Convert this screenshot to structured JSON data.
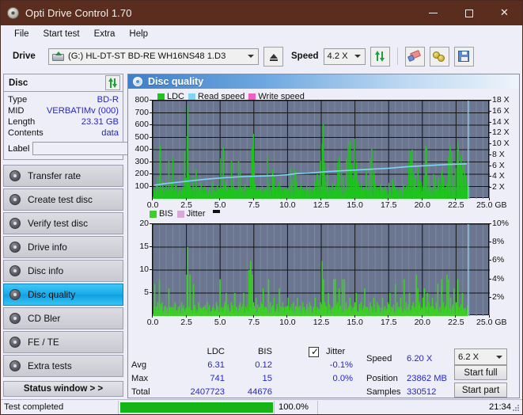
{
  "window": {
    "title": "Opti Drive Control 1.70",
    "icon": "disc-icon",
    "controls": {
      "minimize": "minimize-icon",
      "maximize": "maximize-icon",
      "close": "close-icon"
    }
  },
  "menubar": {
    "items": [
      "File",
      "Start test",
      "Extra",
      "Help"
    ]
  },
  "toolbar": {
    "drive_label": "Drive",
    "drive_value": "(G:)  HL-DT-ST BD-RE  WH16NS48 1.D3",
    "eject_icon": "eject-icon",
    "speed_label": "Speed",
    "speed_value": "4.2 X",
    "refresh_icon": "refresh-icon",
    "erase_icon": "eraser-icon",
    "gold_icon": "coins-icon",
    "save_icon": "save-icon"
  },
  "disc_panel": {
    "title": "Disc",
    "refresh_icon": "refresh-icon",
    "rows": [
      {
        "key": "Type",
        "value": "BD-R"
      },
      {
        "key": "MID",
        "value": "VERBATIMv (000)"
      },
      {
        "key": "Length",
        "value": "23.31 GB"
      },
      {
        "key": "Contents",
        "value": "data"
      }
    ],
    "label_key": "Label",
    "label_value": "",
    "label_placeholder": "",
    "disc_icon": "cd-icon"
  },
  "nav": {
    "items": [
      {
        "id": "transfer-rate",
        "label": "Transfer rate",
        "active": false
      },
      {
        "id": "create-test-disc",
        "label": "Create test disc",
        "active": false
      },
      {
        "id": "verify-test-disc",
        "label": "Verify test disc",
        "active": false
      },
      {
        "id": "drive-info",
        "label": "Drive info",
        "active": false
      },
      {
        "id": "disc-info",
        "label": "Disc info",
        "active": false
      },
      {
        "id": "disc-quality",
        "label": "Disc quality",
        "active": true
      },
      {
        "id": "cd-bler",
        "label": "CD Bler",
        "active": false
      },
      {
        "id": "fe-te",
        "label": "FE / TE",
        "active": false
      },
      {
        "id": "extra-tests",
        "label": "Extra tests",
        "active": false
      }
    ],
    "status_window_label": "Status window > >"
  },
  "panel": {
    "title": "Disc quality",
    "icon": "disc-quality-icon"
  },
  "colors": {
    "ldc_green": "#1fc41f",
    "read_speed": "#7fd4f5",
    "write_speed": "#ef5fc8",
    "bis_green": "#3fce2a",
    "jitter": "#d8a8d8",
    "plot_bg": "#6b7690",
    "accent": "#2626c8",
    "title_bar": "#5a2d1e",
    "progress": "#14b514"
  },
  "stats": {
    "col_headers": [
      "LDC",
      "BIS"
    ],
    "rows": [
      {
        "label": "Avg",
        "ldc": "6.31",
        "bis": "0.12",
        "jitter": "-0.1%"
      },
      {
        "label": "Max",
        "ldc": "741",
        "bis": "15",
        "jitter": "0.0%"
      },
      {
        "label": "Total",
        "ldc": "2407723",
        "bis": "44676",
        "jitter": ""
      }
    ],
    "jitter_label": "Jitter",
    "jitter_checked": true,
    "speed_label": "Speed",
    "speed_value": "6.20 X",
    "position_label": "Position",
    "position_value": "23862 MB",
    "samples_label": "Samples",
    "samples_value": "330512",
    "speed_select": "6.2 X",
    "start_full_label": "Start full",
    "start_part_label": "Start part"
  },
  "statusbar": {
    "text": "Test completed",
    "percent_label": "100.0%",
    "percent_value": 100,
    "time": "21:34"
  },
  "chart_data": [
    {
      "id": "ldc-chart",
      "type": "bar",
      "title": "Disc quality",
      "xlabel": "GB",
      "ylabel": "",
      "xlim": [
        0,
        25
      ],
      "ylim": [
        0,
        800
      ],
      "y2lim": [
        0,
        18
      ],
      "y2label": "X",
      "grid": true,
      "legend": [
        {
          "name": "LDC",
          "color": "#1fc41f"
        },
        {
          "name": "Read speed",
          "color": "#7fd4f5"
        },
        {
          "name": "Write speed",
          "color": "#ef5fc8"
        }
      ],
      "xticks": [
        "0.0",
        "2.5",
        "5.0",
        "7.5",
        "10.0",
        "12.5",
        "15.0",
        "17.5",
        "20.0",
        "22.5",
        "25.0 GB"
      ],
      "yticks": [
        100,
        200,
        300,
        400,
        500,
        600,
        700,
        800
      ],
      "y2ticks": [
        "2 X",
        "4 X",
        "6 X",
        "8 X",
        "10 X",
        "12 X",
        "14 X",
        "16 X",
        "18 X"
      ],
      "series": [
        {
          "name": "LDC",
          "color": "#1fc41f",
          "kind": "bar",
          "x": [
            0.1,
            0.22,
            0.33,
            0.45,
            0.52,
            0.62,
            0.7,
            0.82,
            0.95,
            1.05,
            1.15,
            1.25,
            1.32,
            1.45,
            1.58,
            1.7,
            1.85,
            1.95,
            2.08,
            2.2,
            2.32,
            2.42,
            2.5,
            2.56,
            2.62,
            2.7,
            2.82,
            2.95,
            3.05,
            3.18,
            3.3,
            3.42,
            3.55,
            3.68,
            3.8,
            3.95,
            4.08,
            4.2,
            4.35,
            4.5,
            4.62,
            4.75,
            4.88,
            5.0,
            5.08,
            5.18,
            5.3,
            5.38,
            5.45,
            5.55,
            5.68,
            5.8,
            5.95,
            6.08,
            6.2,
            6.32,
            6.45,
            6.55,
            6.68,
            6.8,
            6.95,
            7.08,
            7.2,
            7.32,
            7.42,
            7.48,
            7.55,
            7.65,
            7.78,
            7.9,
            8.05,
            8.18,
            8.3,
            8.45,
            8.58,
            8.7,
            8.85,
            8.95,
            9.08,
            9.2,
            9.32,
            9.45,
            9.58,
            9.7,
            9.85,
            9.95,
            10.08,
            10.2,
            10.32,
            10.45,
            10.55,
            10.62,
            10.72,
            10.85,
            10.95,
            11.08,
            11.2,
            11.35,
            11.48,
            11.6,
            11.75,
            11.88,
            12.0,
            12.15,
            12.28,
            12.4,
            12.52,
            12.6,
            12.68,
            12.78,
            12.9,
            13.02,
            13.15,
            13.28,
            13.4,
            13.55,
            13.68,
            13.8,
            13.95,
            14.08,
            14.2,
            14.32,
            14.45,
            14.58,
            14.7,
            14.82,
            14.92,
            15.0,
            15.08,
            15.18,
            15.3,
            15.42,
            15.55,
            15.68,
            15.8,
            15.95,
            16.08,
            16.2,
            16.35,
            16.45,
            16.58,
            16.7,
            16.85,
            16.95,
            17.08,
            17.2,
            17.35,
            17.48,
            17.6,
            17.75,
            17.88,
            18.0,
            18.15,
            18.28,
            18.4,
            18.55,
            18.68,
            18.8,
            18.95,
            19.08,
            19.2,
            19.32,
            19.4,
            19.5,
            19.62,
            19.75,
            19.88,
            20.0,
            20.08,
            20.18,
            20.28,
            20.4,
            20.52,
            20.65,
            20.78,
            20.9,
            21.02,
            21.15,
            21.28,
            21.4,
            21.52,
            21.65,
            21.78,
            21.9,
            22.02,
            22.15,
            22.28,
            22.4,
            22.52,
            22.62,
            22.72,
            22.82,
            22.9,
            22.98,
            23.08,
            23.18,
            23.28,
            23.35
          ],
          "values": [
            60,
            120,
            180,
            80,
            440,
            90,
            150,
            70,
            110,
            60,
            310,
            80,
            140,
            330,
            70,
            120,
            60,
            90,
            70,
            100,
            390,
            170,
            510,
            760,
            200,
            110,
            80,
            180,
            60,
            240,
            90,
            70,
            130,
            60,
            100,
            70,
            60,
            90,
            140,
            70,
            60,
            110,
            80,
            330,
            90,
            420,
            110,
            140,
            60,
            70,
            90,
            310,
            120,
            60,
            80,
            310,
            230,
            90,
            70,
            120,
            60,
            90,
            180,
            420,
            530,
            300,
            120,
            70,
            60,
            80,
            60,
            70,
            90,
            340,
            130,
            70,
            240,
            180,
            90,
            70,
            140,
            100,
            60,
            90,
            80,
            70,
            110,
            250,
            160,
            240,
            230,
            140,
            90,
            70,
            120,
            60,
            80,
            90,
            70,
            100,
            60,
            80,
            140,
            200,
            160,
            310,
            450,
            610,
            300,
            140,
            200,
            60,
            90,
            130,
            70,
            110,
            300,
            340,
            240,
            180,
            90,
            330,
            430,
            470,
            280,
            160,
            490,
            230,
            300,
            140,
            90,
            120,
            70,
            90,
            250,
            150,
            330,
            410,
            220,
            130,
            90,
            70,
            120,
            60,
            80,
            100,
            70,
            130,
            90,
            160,
            110,
            70,
            60,
            90,
            70,
            120,
            80,
            110,
            300,
            390,
            400,
            220,
            170,
            90,
            260,
            150,
            140,
            90,
            190,
            430,
            420,
            190,
            110,
            90,
            200,
            160,
            80,
            170,
            120,
            230,
            180,
            90,
            130,
            340,
            430,
            380,
            190,
            250,
            400,
            460,
            280,
            360,
            240,
            140,
            300,
            190,
            110,
            180
          ],
          "width": 0.04
        },
        {
          "name": "Read speed",
          "color": "#7fd4f5",
          "kind": "line",
          "axis": "y2",
          "x": [
            0.1,
            1.0,
            2.5,
            4.0,
            5.5,
            7.0,
            8.5,
            10.0,
            10.6,
            11.5,
            13.0,
            14.5,
            16.0,
            17.5,
            19.0,
            20.5,
            22.0,
            23.3
          ],
          "values": [
            2.5,
            2.8,
            3.2,
            3.6,
            3.9,
            4.1,
            4.2,
            4.4,
            4.6,
            4.7,
            5.0,
            5.2,
            5.4,
            5.6,
            5.9,
            6.1,
            6.3,
            6.4
          ]
        }
      ],
      "cursor_x": 23.4
    },
    {
      "id": "bis-chart",
      "type": "bar",
      "xlabel": "GB",
      "xlim": [
        0,
        25
      ],
      "ylim": [
        0,
        20
      ],
      "y2lim": [
        0,
        10
      ],
      "y2label": "%",
      "grid": true,
      "legend": [
        {
          "name": "BIS",
          "color": "#3fce2a"
        },
        {
          "name": "Jitter",
          "color": "#d8a8d8"
        }
      ],
      "xticks": [
        "0.0",
        "2.5",
        "5.0",
        "7.5",
        "10.0",
        "12.5",
        "15.0",
        "17.5",
        "20.0",
        "22.5",
        "25.0 GB"
      ],
      "yticks": [
        5,
        10,
        15,
        20
      ],
      "y2ticks": [
        "2%",
        "4%",
        "6%",
        "8%",
        "10%"
      ],
      "series": [
        {
          "name": "BIS",
          "color": "#3fce2a",
          "kind": "bar",
          "x": [
            0.1,
            0.22,
            0.33,
            0.45,
            0.55,
            0.65,
            0.78,
            0.9,
            1.02,
            1.15,
            1.22,
            1.35,
            1.48,
            1.6,
            1.72,
            1.85,
            1.98,
            2.1,
            2.22,
            2.35,
            2.48,
            2.55,
            2.65,
            2.72,
            2.85,
            2.98,
            3.1,
            3.22,
            3.35,
            3.48,
            3.6,
            3.75,
            3.88,
            4.0,
            4.15,
            4.28,
            4.4,
            4.55,
            4.68,
            4.8,
            4.95,
            5.08,
            5.2,
            5.32,
            5.4,
            5.52,
            5.65,
            5.78,
            5.9,
            6.05,
            6.18,
            6.3,
            6.45,
            6.58,
            6.7,
            6.85,
            6.98,
            7.1,
            7.22,
            7.35,
            7.42,
            7.5,
            7.62,
            7.75,
            7.88,
            8.0,
            8.15,
            8.28,
            8.4,
            8.55,
            8.68,
            8.8,
            8.95,
            9.08,
            9.2,
            9.35,
            9.48,
            9.6,
            9.75,
            9.88,
            10.0,
            10.15,
            10.28,
            10.4,
            10.55,
            10.68,
            10.8,
            10.95,
            11.08,
            11.2,
            11.35,
            11.48,
            11.6,
            11.75,
            11.88,
            12.0,
            12.15,
            12.28,
            12.4,
            12.52,
            12.62,
            12.72,
            12.85,
            12.98,
            13.1,
            13.25,
            13.38,
            13.5,
            13.65,
            13.78,
            13.9,
            14.05,
            14.18,
            14.3,
            14.45,
            14.58,
            14.7,
            14.85,
            14.95,
            15.05,
            15.15,
            15.28,
            15.4,
            15.55,
            15.68,
            15.8,
            15.95,
            16.08,
            16.2,
            16.35,
            16.48,
            16.6,
            16.75,
            16.88,
            17.0,
            17.15,
            17.28,
            17.4,
            17.55,
            17.68,
            17.8,
            17.95,
            18.08,
            18.2,
            18.35,
            18.48,
            18.6,
            18.75,
            18.88,
            19.0,
            19.15,
            19.28,
            19.4,
            19.5,
            19.62,
            19.75,
            19.88,
            20.0,
            20.1,
            20.2,
            20.32,
            20.45,
            20.58,
            20.7,
            20.85,
            20.98,
            21.1,
            21.25,
            21.38,
            21.5,
            21.65,
            21.78,
            21.9,
            22.05,
            22.18,
            22.3,
            22.45,
            22.58,
            22.7,
            22.82,
            22.92,
            23.02,
            23.12,
            23.22,
            23.32
          ],
          "values": [
            7,
            2,
            3,
            8,
            2,
            3,
            1,
            2,
            1,
            6,
            2,
            1,
            2,
            3,
            1,
            2,
            1,
            3,
            2,
            1,
            9,
            15,
            2,
            9,
            1,
            7,
            2,
            1,
            3,
            2,
            1,
            2,
            1,
            3,
            2,
            1,
            2,
            1,
            3,
            2,
            8,
            2,
            1,
            3,
            5,
            2,
            1,
            3,
            2,
            5,
            2,
            1,
            3,
            2,
            5,
            2,
            1,
            10,
            12,
            9,
            3,
            2,
            4,
            1,
            2,
            3,
            6,
            2,
            1,
            8,
            3,
            2,
            4,
            1,
            2,
            6,
            2,
            3,
            1,
            2,
            4,
            2,
            1,
            3,
            2,
            4,
            2,
            1,
            3,
            2,
            1,
            2,
            3,
            1,
            2,
            4,
            2,
            1,
            3,
            12,
            8,
            3,
            2,
            5,
            1,
            2,
            8,
            8,
            3,
            6,
            2,
            8,
            8,
            3,
            2,
            4,
            1,
            2,
            3,
            5,
            1,
            2,
            3,
            1,
            6,
            2,
            1,
            3,
            2,
            4,
            1,
            3,
            2,
            1,
            4,
            2,
            1,
            3,
            5,
            2,
            1,
            7,
            3,
            2,
            4,
            1,
            8,
            3,
            2,
            5,
            1,
            3,
            2,
            9,
            6,
            3,
            2,
            4,
            6,
            2,
            5,
            3,
            2,
            4,
            1,
            3,
            7,
            2,
            8,
            3,
            2,
            9,
            8,
            4,
            2,
            6,
            3,
            8,
            2,
            1,
            5
          ],
          "width": 0.04
        }
      ],
      "cursor_x": 23.4
    }
  ]
}
